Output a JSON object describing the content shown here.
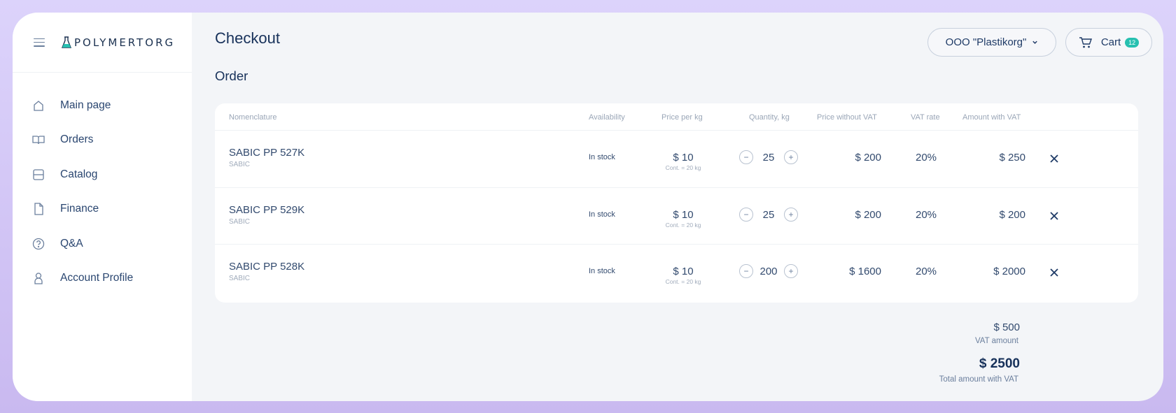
{
  "brand": {
    "logo_text": "POLYMERTORG"
  },
  "sidebar": {
    "items": [
      {
        "label": "Main page",
        "icon": "home-icon"
      },
      {
        "label": "Orders",
        "icon": "book-icon"
      },
      {
        "label": "Catalog",
        "icon": "catalog-icon"
      },
      {
        "label": "Finance",
        "icon": "document-icon"
      },
      {
        "label": "Q&A",
        "icon": "question-icon"
      },
      {
        "label": "Account Profile",
        "icon": "user-icon"
      }
    ]
  },
  "header": {
    "title": "Checkout",
    "org_selector": "OOO \"Plastikorg\"",
    "cart_label": "Cart",
    "cart_count": "12"
  },
  "order": {
    "section_title": "Order",
    "columns": {
      "nomenclature": "Nomenclature",
      "availability": "Availability",
      "price_per_kg": "Price per kg",
      "quantity": "Quantity, kg",
      "price_without_vat": "Price without VAT",
      "vat_rate": "VAT rate",
      "amount_with_vat": "Amount with VAT"
    },
    "rows": [
      {
        "name": "SABIC PP 527K",
        "brand": "SABIC",
        "availability": "In stock",
        "price": "$ 10",
        "container": "Cont. = 20 kg",
        "quantity": "25",
        "price_without_vat": "$ 200",
        "vat_rate": "20%",
        "amount_with_vat": "$ 250"
      },
      {
        "name": "SABIC PP 529K",
        "brand": "SABIC",
        "availability": "In stock",
        "price": "$ 10",
        "container": "Cont. = 20 kg",
        "quantity": "25",
        "price_without_vat": "$ 200",
        "vat_rate": "20%",
        "amount_with_vat": "$ 200"
      },
      {
        "name": "SABIC PP 528K",
        "brand": "SABIC",
        "availability": "In stock",
        "price": "$ 10",
        "container": "Cont. = 20 kg",
        "quantity": "200",
        "price_without_vat": "$ 1600",
        "vat_rate": "20%",
        "amount_with_vat": "$ 2000"
      }
    ]
  },
  "summary": {
    "vat_amount": "$ 500",
    "vat_amount_label": "VAT amount",
    "total": "$ 2500",
    "total_label": "Total amount with VAT"
  },
  "colors": {
    "accent": "#27c0b0",
    "primary_text": "#17315a",
    "background": "#f3f5f8",
    "frame_border": "#d7ccf8"
  }
}
